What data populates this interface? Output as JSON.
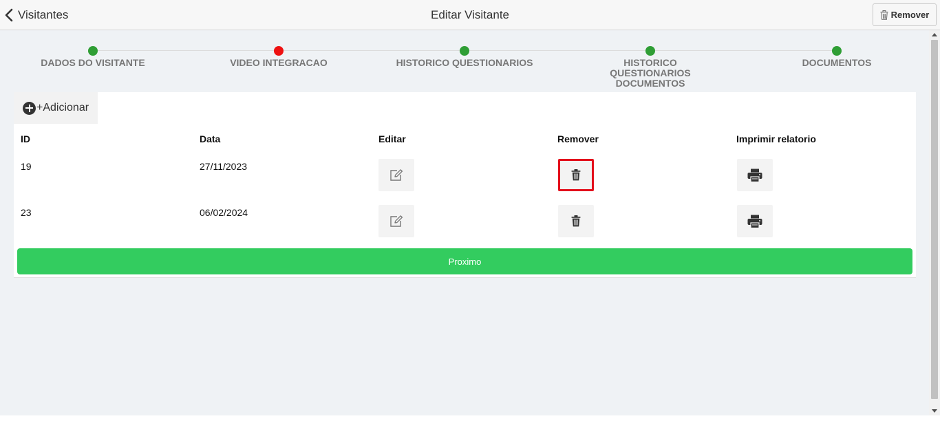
{
  "header": {
    "back_label": "Visitantes",
    "title": "Editar Visitante",
    "remove_label": "Remover"
  },
  "steps": [
    {
      "label": "DADOS DO VISITANTE",
      "status_color": "#2f9e35"
    },
    {
      "label": "VIDEO INTEGRACAO",
      "status_color": "#ee1111"
    },
    {
      "label": "HISTORICO QUESTIONARIOS",
      "status_color": "#2f9e35"
    },
    {
      "label": "HISTORICO QUESTIONARIOS DOCUMENTOS",
      "status_color": "#2f9e35"
    },
    {
      "label": "DOCUMENTOS",
      "status_color": "#2f9e35"
    }
  ],
  "toolbar": {
    "add_label": "+Adicionar"
  },
  "table": {
    "columns": [
      "ID",
      "Data",
      "Editar",
      "Remover",
      "Imprimir relatorio"
    ],
    "rows": [
      {
        "id": "19",
        "date": "27/11/2023"
      },
      {
        "id": "23",
        "date": "06/02/2024"
      }
    ]
  },
  "footer": {
    "next_label": "Proximo"
  },
  "colors": {
    "accent_green": "#33cc5f",
    "highlight_red": "#e30f1b"
  },
  "icons": {
    "back": "chevron-left-icon",
    "remove": "trash-icon",
    "add": "plus-circle-icon",
    "edit": "edit-icon",
    "delete": "trash-icon",
    "print": "printer-icon"
  }
}
